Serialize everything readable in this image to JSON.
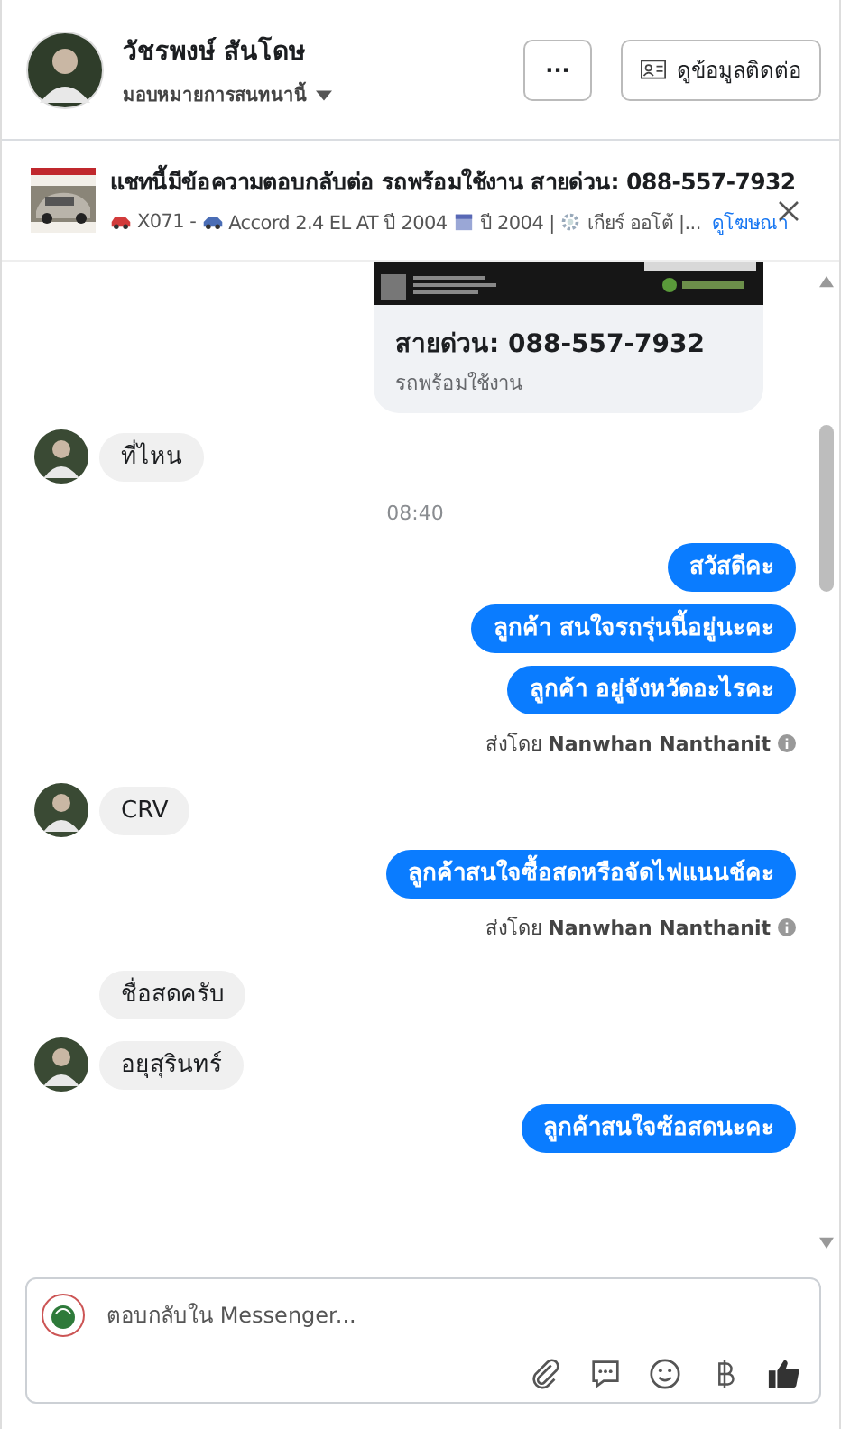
{
  "header": {
    "name": "วัชรพงษ์ สันโดษ",
    "assign": "มอบหมายการสนทนานี้",
    "more_button": "···",
    "contact_button": "ดูข้อมูลติดต่อ"
  },
  "ad_banner": {
    "title": "แชทนี้มีข้อความตอบกลับต่อ รถพร้อมใช้งาน สายด่วน: 088-557-7932",
    "meta": [
      {
        "kind": "car",
        "text": "X071 -"
      },
      {
        "kind": "sedan",
        "text": "Accord 2.4 EL AT ปี 2004"
      },
      {
        "kind": "calendar",
        "text": "ปี 2004 |"
      },
      {
        "kind": "gear",
        "text": "เกียร์ ออโต้ |..."
      }
    ],
    "link": "ดูโฆษณา"
  },
  "messages": [
    {
      "kind": "card",
      "title": "สายด่วน: 088-557-7932",
      "subtitle": "รถพร้อมใช้งาน"
    },
    {
      "kind": "incoming",
      "text": "ที่ไหน",
      "avatar": true
    },
    {
      "kind": "time",
      "text": "08:40"
    },
    {
      "kind": "outgoing",
      "text": "สวัสดีคะ"
    },
    {
      "kind": "outgoing",
      "text": "ลูกค้า สนใจรถรุ่นนี้อยู่นะคะ"
    },
    {
      "kind": "outgoing",
      "text": "ลูกค้า  อยู่จังหวัดอะไรคะ"
    },
    {
      "kind": "sent_by",
      "text": "ส่งโดย **Nanwhan Nanthanit**"
    },
    {
      "kind": "incoming",
      "text": "CRV",
      "avatar": true
    },
    {
      "kind": "outgoing",
      "text": "ลูกค้าสนใจซื้อสดหรือจัดไฟแนนช์คะ"
    },
    {
      "kind": "sent_by",
      "text": "ส่งโดย **Nanwhan Nanthanit**"
    },
    {
      "kind": "incoming",
      "text": "ชื่อสดครับ",
      "avatar": false
    },
    {
      "kind": "incoming",
      "text": "อยุสุรินทร์",
      "avatar": true
    },
    {
      "kind": "outgoing",
      "text": "ลูกค้าสนใจซ้อสดนะคะ"
    }
  ],
  "composer": {
    "placeholder": "ตอบกลับใน Messenger..."
  }
}
